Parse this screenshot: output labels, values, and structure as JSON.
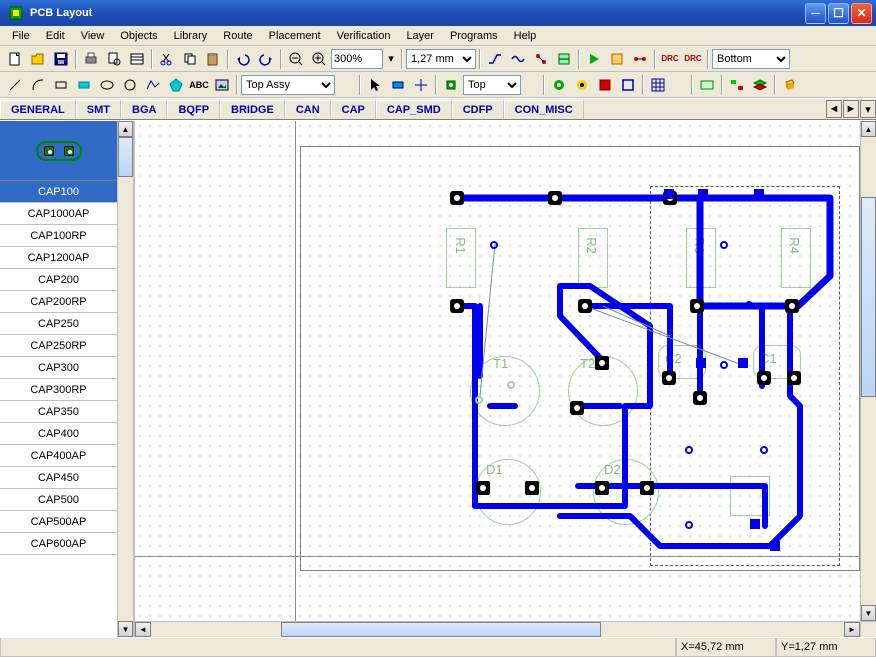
{
  "titlebar": {
    "title": "PCB Layout",
    "app_icon": "◈"
  },
  "menu": [
    "File",
    "Edit",
    "View",
    "Objects",
    "Library",
    "Route",
    "Placement",
    "Verification",
    "Layer",
    "Programs",
    "Help"
  ],
  "toolbar1": {
    "zoom_value": "300%",
    "grid_value": "1,27 mm",
    "layer_value": "Bottom"
  },
  "toolbar2": {
    "display_layer": "Top Assy",
    "active_layer": "Top"
  },
  "tabs": [
    "GENERAL",
    "SMT",
    "BGA",
    "BQFP",
    "BRIDGE",
    "CAN",
    "CAP",
    "CAP_SMD",
    "CDFP",
    "CON_MISC"
  ],
  "sidebar": {
    "preview_label": "CAP100",
    "components": [
      "CAP100",
      "CAP1000AP",
      "CAP100RP",
      "CAP1200AP",
      "CAP200",
      "CAP200RP",
      "CAP250",
      "CAP250RP",
      "CAP300",
      "CAP300RP",
      "CAP350",
      "CAP400",
      "CAP400AP",
      "CAP450",
      "CAP500",
      "CAP500AP",
      "CAP600AP"
    ],
    "selected_index": 0
  },
  "canvas": {
    "refdes": [
      "R1",
      "R2",
      "R3",
      "R4",
      "T1",
      "T2",
      "C2",
      "C1",
      "D1",
      "D2"
    ]
  },
  "status": {
    "x": "X=45,72 mm",
    "y": "Y=1,27 mm"
  }
}
